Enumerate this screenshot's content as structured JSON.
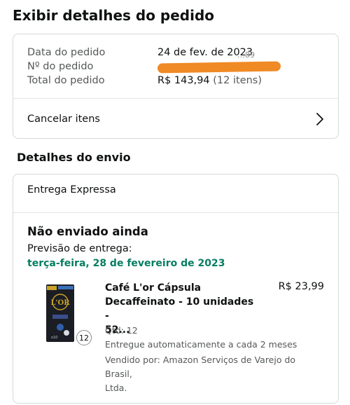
{
  "page": {
    "title": "Exibir detalhes do pedido"
  },
  "order": {
    "date_label": "Data do pedido",
    "date_value": "24 de fev. de 2023",
    "number_label": "Nº do pedido",
    "number_value_visible": "…89",
    "total_label": "Total do pedido",
    "total_value": "R$ 143,94",
    "total_items": "(12 itens)"
  },
  "actions": {
    "cancel_label": "Cancelar itens"
  },
  "shipping": {
    "section_title": "Detalhes do envio",
    "method": "Entrega Expressa",
    "status": "Não enviado ainda",
    "eta_label": "Previsão de entrega:",
    "eta_date": "terça-feira, 28 de fevereiro de 2023"
  },
  "product": {
    "name_line1": "Café L'or Cápsula",
    "name_line2": "Decaffeinato - 10 unidades -",
    "name_line3": "52...",
    "price": "R$ 23,99",
    "qty": "Qtd: 12",
    "qty_badge": "12",
    "auto_delivery": "Entregue automaticamente a cada 2 meses",
    "seller_line1": "Vendido por: Amazon Serviços de Varejo do Brasil,",
    "seller_line2": "Ltda."
  },
  "colors": {
    "eta": "#067d62",
    "redaction": "#f08a24",
    "border": "#d5d9d9"
  }
}
